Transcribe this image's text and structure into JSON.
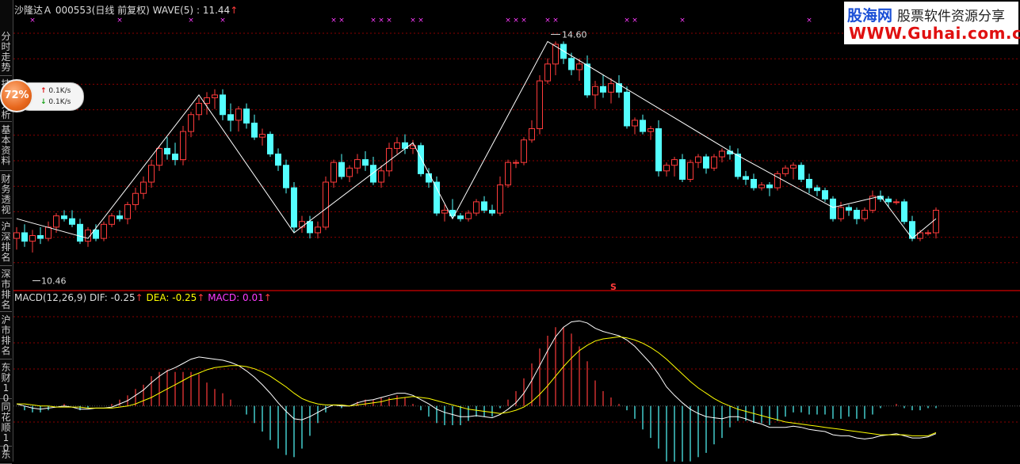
{
  "header": {
    "stock_name": "沙隆达Ａ",
    "stock_code": "000553",
    "period": "(日线 前复权)",
    "indicator": "WAVE(5)",
    "indicator_value": "11.44",
    "up_arrow": "↑"
  },
  "macd_header": {
    "name": "MACD(12,26,9)",
    "dif_label": "DIF:",
    "dif_value": "-0.25",
    "dea_label": "DEA:",
    "dea_value": "-0.25",
    "macd_label": "MACD:",
    "macd_value": "0.01",
    "up_arrow": "↑"
  },
  "sidebar": {
    "tabs": [
      {
        "label": "分时走势"
      },
      {
        "label": "技术分析"
      },
      {
        "label": "基本资料"
      },
      {
        "label": "财务透视"
      },
      {
        "label": "沪深排名"
      },
      {
        "label": "深市排名"
      },
      {
        "label": "沪市排名"
      },
      {
        "label": "东财10"
      },
      {
        "label": "同花顺10"
      },
      {
        "label": "东"
      }
    ]
  },
  "speed": {
    "percent": "72%",
    "up_rate": "0.1K/s",
    "down_rate": "0.1K/s"
  },
  "watermark": {
    "brand": "股海网",
    "slogan": "股票软件资源分享",
    "url": "WWW.Guhai.com.cn"
  },
  "colors": {
    "up": "#ff3b3b",
    "down": "#54ffff",
    "wave": "#ffffff",
    "dif": "#ffffff",
    "dea": "#ffff00",
    "grid": "#8b0000",
    "marker": "#ff3bff"
  },
  "chart_data": [
    {
      "type": "candlestick",
      "title": "WAVE(5)",
      "ylim": [
        10.2,
        15.0
      ],
      "high_label": "14.60",
      "low_label": "10.46",
      "marker_s": "S",
      "candles": [
        [
          11.1,
          11.3,
          10.9,
          11.2
        ],
        [
          11.2,
          11.35,
          10.95,
          11.05
        ],
        [
          11.05,
          11.25,
          10.85,
          11.15
        ],
        [
          11.15,
          11.3,
          11.0,
          11.1
        ],
        [
          11.1,
          11.4,
          11.05,
          11.3
        ],
        [
          11.3,
          11.55,
          11.2,
          11.5
        ],
        [
          11.5,
          11.6,
          11.4,
          11.45
        ],
        [
          11.45,
          11.6,
          11.3,
          11.35
        ],
        [
          11.35,
          11.45,
          11.0,
          11.05
        ],
        [
          11.05,
          11.3,
          10.95,
          11.25
        ],
        [
          11.25,
          11.35,
          11.05,
          11.1
        ],
        [
          11.1,
          11.4,
          11.05,
          11.35
        ],
        [
          11.35,
          11.55,
          11.3,
          11.5
        ],
        [
          11.5,
          11.6,
          11.4,
          11.45
        ],
        [
          11.45,
          11.75,
          11.35,
          11.7
        ],
        [
          11.7,
          12.0,
          11.6,
          11.9
        ],
        [
          11.9,
          12.2,
          11.8,
          12.1
        ],
        [
          12.1,
          12.5,
          12.0,
          12.4
        ],
        [
          12.4,
          12.75,
          12.3,
          12.7
        ],
        [
          12.7,
          12.9,
          12.5,
          12.6
        ],
        [
          12.6,
          12.8,
          12.4,
          12.5
        ],
        [
          12.5,
          13.1,
          12.4,
          13.0
        ],
        [
          13.0,
          13.35,
          12.9,
          13.3
        ],
        [
          13.3,
          13.6,
          13.2,
          13.5
        ],
        [
          13.5,
          13.7,
          13.3,
          13.6
        ],
        [
          13.6,
          13.75,
          13.4,
          13.65
        ],
        [
          13.65,
          13.75,
          13.2,
          13.3
        ],
        [
          13.3,
          13.5,
          13.0,
          13.2
        ],
        [
          13.2,
          13.45,
          13.0,
          13.4
        ],
        [
          13.4,
          13.5,
          13.05,
          13.15
        ],
        [
          13.15,
          13.3,
          12.85,
          12.9
        ],
        [
          12.9,
          13.05,
          12.75,
          12.95
        ],
        [
          12.95,
          13.0,
          12.55,
          12.6
        ],
        [
          12.6,
          12.7,
          12.3,
          12.4
        ],
        [
          12.4,
          12.5,
          11.9,
          12.0
        ],
        [
          12.0,
          12.1,
          11.2,
          11.3
        ],
        [
          11.3,
          11.5,
          11.2,
          11.4
        ],
        [
          11.4,
          11.5,
          11.1,
          11.2
        ],
        [
          11.2,
          11.4,
          11.1,
          11.3
        ],
        [
          11.3,
          12.2,
          11.25,
          12.1
        ],
        [
          12.1,
          12.5,
          12.0,
          12.45
        ],
        [
          12.45,
          12.6,
          12.15,
          12.2
        ],
        [
          12.2,
          12.4,
          12.1,
          12.35
        ],
        [
          12.35,
          12.6,
          12.25,
          12.5
        ],
        [
          12.5,
          12.65,
          12.3,
          12.4
        ],
        [
          12.4,
          12.55,
          12.05,
          12.1
        ],
        [
          12.1,
          12.4,
          12.0,
          12.3
        ],
        [
          12.3,
          12.8,
          12.2,
          12.7
        ],
        [
          12.7,
          12.9,
          12.6,
          12.8
        ],
        [
          12.8,
          12.95,
          12.6,
          12.7
        ],
        [
          12.7,
          12.85,
          12.6,
          12.75
        ],
        [
          12.75,
          12.8,
          12.2,
          12.25
        ],
        [
          12.25,
          12.35,
          12.0,
          12.1
        ],
        [
          12.1,
          12.2,
          11.5,
          11.55
        ],
        [
          11.55,
          11.7,
          11.4,
          11.6
        ],
        [
          11.6,
          11.8,
          11.45,
          11.5
        ],
        [
          11.5,
          11.55,
          11.4,
          11.45
        ],
        [
          11.45,
          11.6,
          11.4,
          11.55
        ],
        [
          11.55,
          11.8,
          11.5,
          11.75
        ],
        [
          11.75,
          11.85,
          11.55,
          11.6
        ],
        [
          11.6,
          11.7,
          11.5,
          11.55
        ],
        [
          11.55,
          12.2,
          11.5,
          12.05
        ],
        [
          12.05,
          12.5,
          12.0,
          12.45
        ],
        [
          12.45,
          12.5,
          12.35,
          12.45
        ],
        [
          12.45,
          12.9,
          12.4,
          12.85
        ],
        [
          12.85,
          13.2,
          12.8,
          13.05
        ],
        [
          13.05,
          14.0,
          12.95,
          13.9
        ],
        [
          13.9,
          14.3,
          13.85,
          14.2
        ],
        [
          14.2,
          14.6,
          14.0,
          14.55
        ],
        [
          14.55,
          14.6,
          14.2,
          14.3
        ],
        [
          14.3,
          14.4,
          14.0,
          14.1
        ],
        [
          14.1,
          14.3,
          13.9,
          14.2
        ],
        [
          14.2,
          14.35,
          13.6,
          13.65
        ],
        [
          13.65,
          13.9,
          13.4,
          13.8
        ],
        [
          13.8,
          14.0,
          13.6,
          13.7
        ],
        [
          13.7,
          13.95,
          13.5,
          13.85
        ],
        [
          13.85,
          14.0,
          13.6,
          13.7
        ],
        [
          13.7,
          13.8,
          13.05,
          13.1
        ],
        [
          13.1,
          13.25,
          12.95,
          13.2
        ],
        [
          13.2,
          13.3,
          12.95,
          13.0
        ],
        [
          13.0,
          13.1,
          12.85,
          13.05
        ],
        [
          13.05,
          13.2,
          12.2,
          12.3
        ],
        [
          12.3,
          12.45,
          12.2,
          12.4
        ],
        [
          12.4,
          12.55,
          12.2,
          12.5
        ],
        [
          12.5,
          12.6,
          12.1,
          12.15
        ],
        [
          12.15,
          12.5,
          12.1,
          12.45
        ],
        [
          12.45,
          12.6,
          12.35,
          12.55
        ],
        [
          12.55,
          12.6,
          12.25,
          12.35
        ],
        [
          12.35,
          12.6,
          12.3,
          12.55
        ],
        [
          12.55,
          12.7,
          12.45,
          12.65
        ],
        [
          12.65,
          12.75,
          12.5,
          12.6
        ],
        [
          12.6,
          12.7,
          12.15,
          12.2
        ],
        [
          12.2,
          12.3,
          12.05,
          12.15
        ],
        [
          12.15,
          12.25,
          11.95,
          12.0
        ],
        [
          12.0,
          12.1,
          11.95,
          12.05
        ],
        [
          12.05,
          12.1,
          11.85,
          12.0
        ],
        [
          12.0,
          12.3,
          11.95,
          12.25
        ],
        [
          12.25,
          12.4,
          12.2,
          12.35
        ],
        [
          12.35,
          12.45,
          12.15,
          12.4
        ],
        [
          12.4,
          12.45,
          12.1,
          12.15
        ],
        [
          12.15,
          12.25,
          11.9,
          12.0
        ],
        [
          12.0,
          12.05,
          11.85,
          11.95
        ],
        [
          11.95,
          12.0,
          11.75,
          11.8
        ],
        [
          11.8,
          11.85,
          11.4,
          11.45
        ],
        [
          11.45,
          11.75,
          11.4,
          11.65
        ],
        [
          11.65,
          11.7,
          11.5,
          11.6
        ],
        [
          11.6,
          11.65,
          11.35,
          11.45
        ],
        [
          11.45,
          11.65,
          11.4,
          11.6
        ],
        [
          11.6,
          11.95,
          11.55,
          11.85
        ],
        [
          11.85,
          11.95,
          11.75,
          11.8
        ],
        [
          11.8,
          11.85,
          11.65,
          11.75
        ],
        [
          11.75,
          11.8,
          11.7,
          11.75
        ],
        [
          11.75,
          11.8,
          11.35,
          11.4
        ],
        [
          11.4,
          11.5,
          11.05,
          11.1
        ],
        [
          11.1,
          11.25,
          11.05,
          11.2
        ],
        [
          11.2,
          11.25,
          11.15,
          11.2
        ],
        [
          11.2,
          11.65,
          11.1,
          11.6
        ]
      ],
      "wave_points": [
        [
          0,
          11.45
        ],
        [
          9,
          11.1
        ],
        [
          23,
          13.65
        ],
        [
          35,
          11.2
        ],
        [
          50,
          12.8
        ],
        [
          55,
          11.45
        ],
        [
          67,
          14.6
        ],
        [
          90,
          12.65
        ],
        [
          103,
          11.65
        ],
        [
          109,
          11.85
        ],
        [
          113,
          11.1
        ],
        [
          116,
          11.45
        ]
      ],
      "markers_x": [
        2,
        13,
        22,
        26,
        40,
        41,
        45,
        46,
        47,
        50,
        51,
        62,
        63,
        64,
        67,
        68,
        77,
        78,
        84,
        100
      ]
    },
    {
      "type": "macd",
      "title": "MACD(12,26,9)",
      "series": [
        {
          "name": "DIF",
          "values": [
            0.02,
            0.0,
            -0.02,
            -0.03,
            -0.02,
            -0.01,
            0.0,
            -0.01,
            -0.03,
            -0.03,
            -0.02,
            -0.02,
            -0.01,
            0.02,
            0.05,
            0.1,
            0.15,
            0.22,
            0.28,
            0.33,
            0.36,
            0.4,
            0.44,
            0.46,
            0.45,
            0.44,
            0.43,
            0.41,
            0.38,
            0.33,
            0.27,
            0.2,
            0.12,
            0.03,
            -0.05,
            -0.12,
            -0.13,
            -0.1,
            -0.06,
            -0.02,
            0.01,
            0.0,
            0.0,
            0.03,
            0.05,
            0.06,
            0.08,
            0.1,
            0.12,
            0.12,
            0.1,
            0.06,
            0.02,
            -0.03,
            -0.06,
            -0.08,
            -0.1,
            -0.1,
            -0.09,
            -0.1,
            -0.11,
            -0.08,
            -0.03,
            0.03,
            0.12,
            0.24,
            0.38,
            0.52,
            0.65,
            0.74,
            0.79,
            0.8,
            0.78,
            0.73,
            0.7,
            0.68,
            0.66,
            0.62,
            0.56,
            0.48,
            0.4,
            0.3,
            0.18,
            0.1,
            0.03,
            -0.03,
            -0.07,
            -0.1,
            -0.11,
            -0.12,
            -0.1,
            -0.1,
            -0.12,
            -0.15,
            -0.17,
            -0.2,
            -0.2,
            -0.2,
            -0.19,
            -0.2,
            -0.22,
            -0.23,
            -0.24,
            -0.27,
            -0.28,
            -0.28,
            -0.3,
            -0.31,
            -0.3,
            -0.28,
            -0.27,
            -0.26,
            -0.28,
            -0.3,
            -0.3,
            -0.29,
            -0.26
          ]
        },
        {
          "name": "DEA",
          "values": [
            0.02,
            0.02,
            0.01,
            0.0,
            0.0,
            -0.01,
            -0.01,
            -0.01,
            -0.01,
            -0.02,
            -0.02,
            -0.02,
            -0.02,
            -0.01,
            0.0,
            0.02,
            0.05,
            0.08,
            0.12,
            0.16,
            0.2,
            0.24,
            0.28,
            0.31,
            0.34,
            0.36,
            0.37,
            0.38,
            0.38,
            0.37,
            0.35,
            0.32,
            0.28,
            0.23,
            0.18,
            0.12,
            0.07,
            0.04,
            0.02,
            0.01,
            0.01,
            0.01,
            0.0,
            0.01,
            0.02,
            0.03,
            0.04,
            0.06,
            0.07,
            0.08,
            0.09,
            0.08,
            0.07,
            0.05,
            0.03,
            0.01,
            -0.01,
            -0.03,
            -0.04,
            -0.05,
            -0.06,
            -0.07,
            -0.06,
            -0.04,
            -0.01,
            0.04,
            0.11,
            0.19,
            0.28,
            0.37,
            0.45,
            0.52,
            0.57,
            0.61,
            0.63,
            0.64,
            0.65,
            0.64,
            0.62,
            0.59,
            0.55,
            0.5,
            0.44,
            0.37,
            0.3,
            0.23,
            0.17,
            0.12,
            0.07,
            0.03,
            0.0,
            -0.03,
            -0.05,
            -0.07,
            -0.09,
            -0.11,
            -0.13,
            -0.15,
            -0.16,
            -0.17,
            -0.18,
            -0.19,
            -0.2,
            -0.21,
            -0.22,
            -0.23,
            -0.24,
            -0.25,
            -0.26,
            -0.27,
            -0.27,
            -0.27,
            -0.27,
            -0.28,
            -0.28,
            -0.28,
            -0.25
          ]
        }
      ],
      "ylim": [
        -0.5,
        0.95
      ]
    }
  ]
}
